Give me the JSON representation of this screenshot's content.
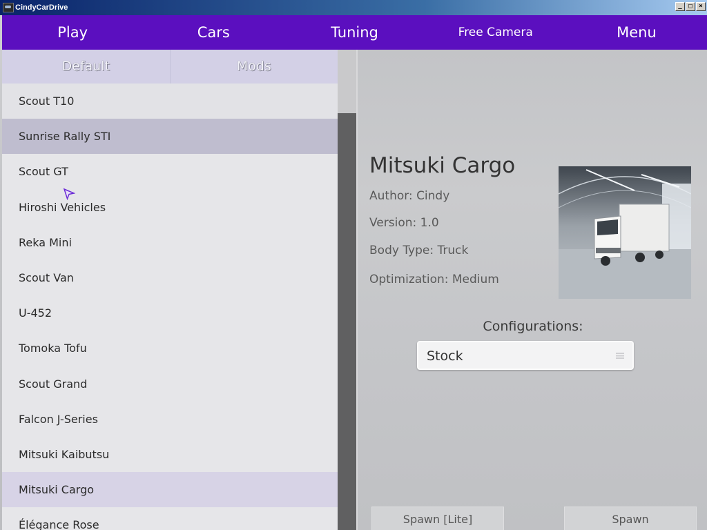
{
  "window": {
    "title": "CindyCarDrive",
    "controls": {
      "minimize": "_",
      "maximize": "□",
      "close": "×"
    }
  },
  "nav": {
    "items": [
      {
        "label": "Play"
      },
      {
        "label": "Cars"
      },
      {
        "label": "Tuning"
      },
      {
        "label": "Free Camera"
      },
      {
        "label": "Menu"
      }
    ],
    "color": "#5b0fbf"
  },
  "tabs": [
    {
      "label": "Default"
    },
    {
      "label": "Mods"
    }
  ],
  "car_list": [
    "Scout T10",
    "Sunrise Rally STI",
    "Scout GT",
    "Hiroshi Vehicles",
    "Reka Mini",
    "Scout Van",
    "U-452",
    "Tomoka Tofu",
    "Scout Grand",
    "Falcon J-Series",
    "Mitsuki Kaibutsu",
    "Mitsuki Cargo",
    "Élégance Rose"
  ],
  "details": {
    "name": "Mitsuki Cargo",
    "author": "Author: Cindy",
    "version": "Version: 1.0",
    "body_type": "Body Type: Truck",
    "optimization": "Optimization: Medium",
    "preview_icon": "truck-preview-image"
  },
  "configurations": {
    "label": "Configurations:",
    "selected": "Stock"
  },
  "actions": {
    "spawn_lite": "Spawn [Lite]",
    "spawn": "Spawn"
  }
}
